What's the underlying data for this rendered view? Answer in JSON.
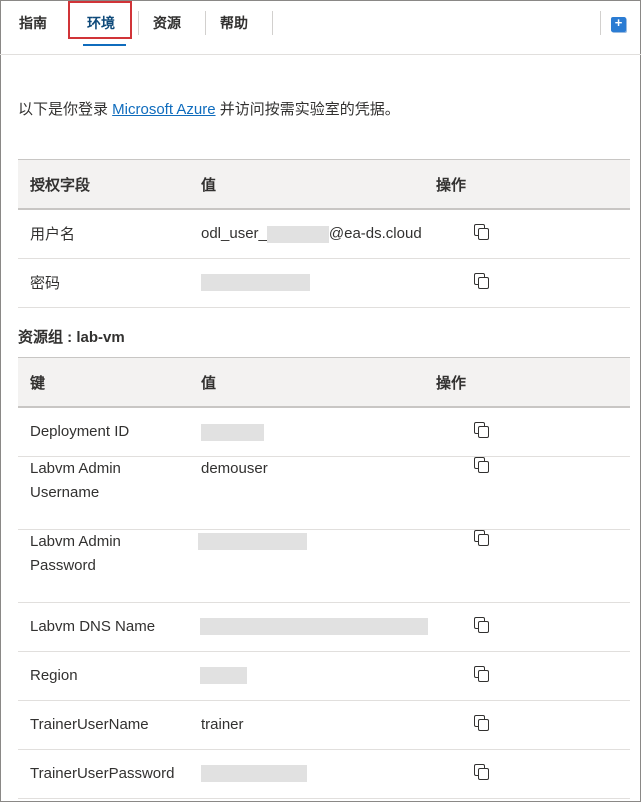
{
  "tabs": [
    {
      "label": "指南"
    },
    {
      "label": "环境"
    },
    {
      "label": "资源"
    },
    {
      "label": "帮助"
    }
  ],
  "intro": {
    "before": "以下是你登录 ",
    "link": "Microsoft Azure",
    "after": " 并访问按需实验室的凭据。"
  },
  "auth_table": {
    "headers": [
      "授权字段",
      "值",
      "操作"
    ],
    "rows": [
      {
        "field": "用户名",
        "value_prefix": "odl_user_",
        "value_suffix": "@ea-ds.cloud"
      },
      {
        "field": "密码"
      }
    ]
  },
  "resource_group": {
    "title": "资源组 : lab-vm"
  },
  "resource_table": {
    "headers": [
      "键",
      "值",
      "操作"
    ],
    "rows": [
      {
        "key": "Deployment ID",
        "value": ""
      },
      {
        "key": "Labvm Admin Username",
        "value": "demouser"
      },
      {
        "key": "Labvm Admin Password",
        "value": ""
      },
      {
        "key": "Labvm DNS Name",
        "value": ""
      },
      {
        "key": "Region",
        "value": ""
      },
      {
        "key": "TrainerUserName",
        "value": "trainer"
      },
      {
        "key": "TrainerUserPassword",
        "value": ""
      }
    ]
  },
  "icons": {
    "copy": "copy-icon",
    "corner": "add-panel-icon"
  },
  "colors": {
    "link": "#0f6cbd",
    "active_tab": "#0f4a7a",
    "highlight": "#d13438",
    "redaction": "#e1e1e1"
  }
}
